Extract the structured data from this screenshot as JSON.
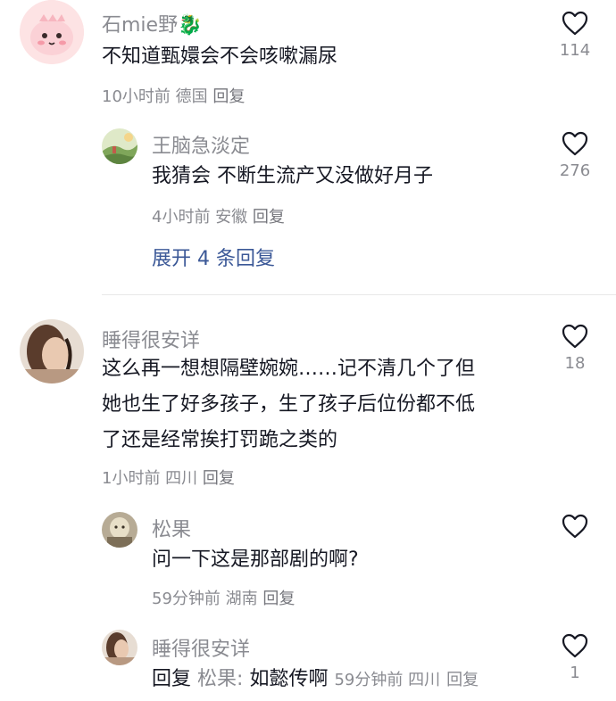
{
  "comments": [
    {
      "username": "石mie野🐉",
      "text": "不知道甄嬛会不会咳嗽漏尿",
      "meta": "10小时前 德国",
      "reply_label": "回复",
      "likes": "114"
    },
    {
      "username": "王脑急淡定",
      "text": "我猜会 不断生流产又没做好月子",
      "meta": "4小时前 安徽",
      "reply_label": "回复",
      "likes": "276"
    },
    {
      "username": "睡得很安详",
      "text_lines": [
        "这么再一想想隔壁婉婉……记不清几个了但",
        "她也生了好多孩子，生了孩子后位份都不低",
        "了还是经常挨打罚跪之类的"
      ],
      "meta": "1小时前 四川",
      "reply_label": "回复",
      "likes": "18"
    },
    {
      "username": "松果",
      "text": "问一下这是那部剧的啊?",
      "meta": "59分钟前 湖南",
      "reply_label": "回复",
      "likes": ""
    },
    {
      "username": "睡得很安详",
      "reply_prefix": "回复",
      "reply_to": "松果:",
      "text": "如懿传啊",
      "meta": "59分钟前 四川",
      "reply_label": "回复",
      "likes": "1"
    }
  ],
  "expand_replies": "展开 4 条回复",
  "colors": {
    "link": "#3b5897",
    "muted": "#8a8b91",
    "text": "#161823"
  },
  "icons": {
    "like": "heart-outline-icon"
  }
}
